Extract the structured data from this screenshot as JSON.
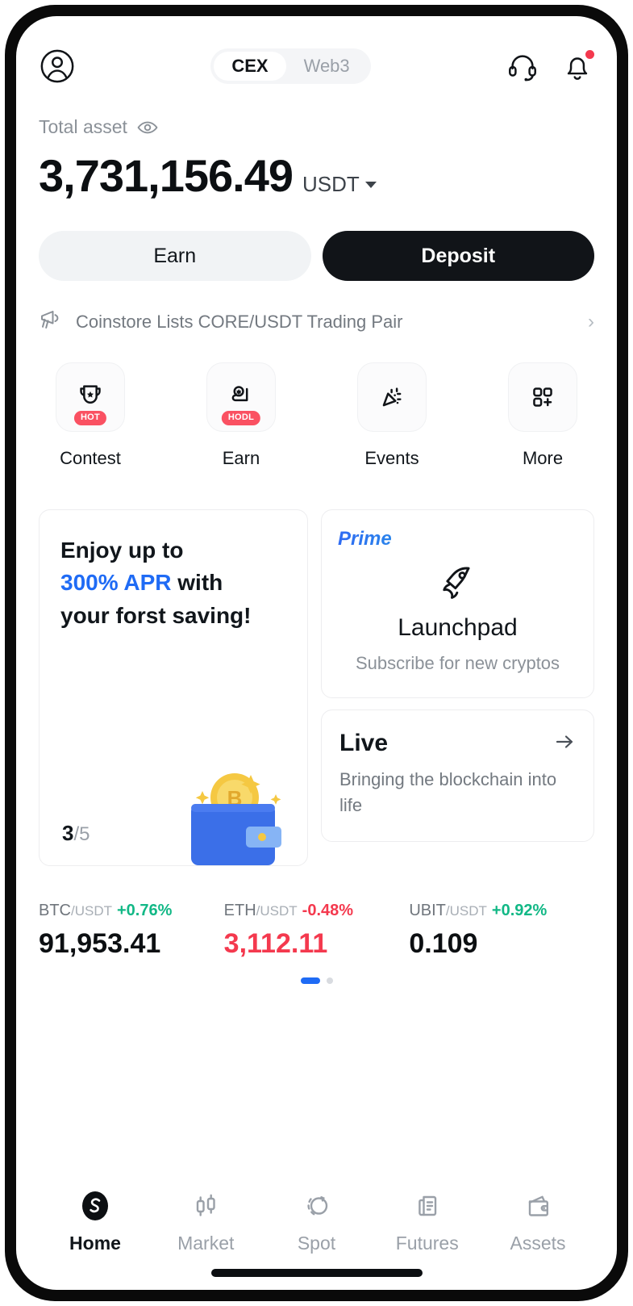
{
  "header": {
    "profile_icon": "user-circle-icon",
    "tabs": [
      {
        "label": "CEX",
        "active": true
      },
      {
        "label": "Web3",
        "active": false
      }
    ],
    "support_icon": "headset-icon",
    "notification_icon": "bell-icon",
    "notification_badge": true
  },
  "balance": {
    "label": "Total asset",
    "eye_icon": "eye-icon",
    "amount": "3,731,156.49",
    "currency": "USDT",
    "currency_caret": "chevron-down-icon"
  },
  "actions": {
    "earn_label": "Earn",
    "deposit_label": "Deposit"
  },
  "announcement": {
    "icon": "megaphone-icon",
    "text": "Coinstore Lists CORE/USDT Trading Pair",
    "chevron": "›"
  },
  "quick_actions": [
    {
      "label": "Contest",
      "icon": "trophy-icon",
      "badge": "HOT"
    },
    {
      "label": "Earn",
      "icon": "hand-coin-icon",
      "badge": "HODL"
    },
    {
      "label": "Events",
      "icon": "confetti-icon",
      "badge": ""
    },
    {
      "label": "More",
      "icon": "grid-plus-icon",
      "badge": ""
    }
  ],
  "promo_card": {
    "line1": "Enjoy up to",
    "accent": "300% APR",
    "line2_tail": " with",
    "line3": "your forst saving!",
    "counter_current": "3",
    "counter_total": "/5",
    "art": "wallet-bitcoin-illustration"
  },
  "launchpad_card": {
    "tag": "Prime",
    "icon": "rocket-icon",
    "title": "Launchpad",
    "subtitle": "Subscribe for new cryptos"
  },
  "live_card": {
    "title": "Live",
    "arrow_icon": "arrow-right-icon",
    "subtitle": "Bringing the blockchain into life"
  },
  "tickers": [
    {
      "base": "BTC",
      "quote": "/USDT",
      "change": "+0.76%",
      "direction": "up",
      "price": "91,953.41",
      "price_negative": false
    },
    {
      "base": "ETH",
      "quote": "/USDT",
      "change": "-0.48%",
      "direction": "down",
      "price": "3,112.11",
      "price_negative": true
    },
    {
      "base": "UBIT",
      "quote": "/USDT",
      "change": "+0.92%",
      "direction": "up",
      "price": "0.109",
      "price_negative": false
    }
  ],
  "carousel": {
    "pages": 2,
    "active_index": 0
  },
  "bottom_nav": [
    {
      "label": "Home",
      "icon": "coinstore-logo-icon",
      "active": true
    },
    {
      "label": "Market",
      "icon": "candlestick-icon",
      "active": false
    },
    {
      "label": "Spot",
      "icon": "swap-circles-icon",
      "active": false
    },
    {
      "label": "Futures",
      "icon": "document-chart-icon",
      "active": false
    },
    {
      "label": "Assets",
      "icon": "wallet-icon",
      "active": false
    }
  ],
  "colors": {
    "accent_blue": "#1f6bf5",
    "up_green": "#12b886",
    "down_red": "#f4394e",
    "badge_red": "#fa5162",
    "dark": "#111418"
  }
}
